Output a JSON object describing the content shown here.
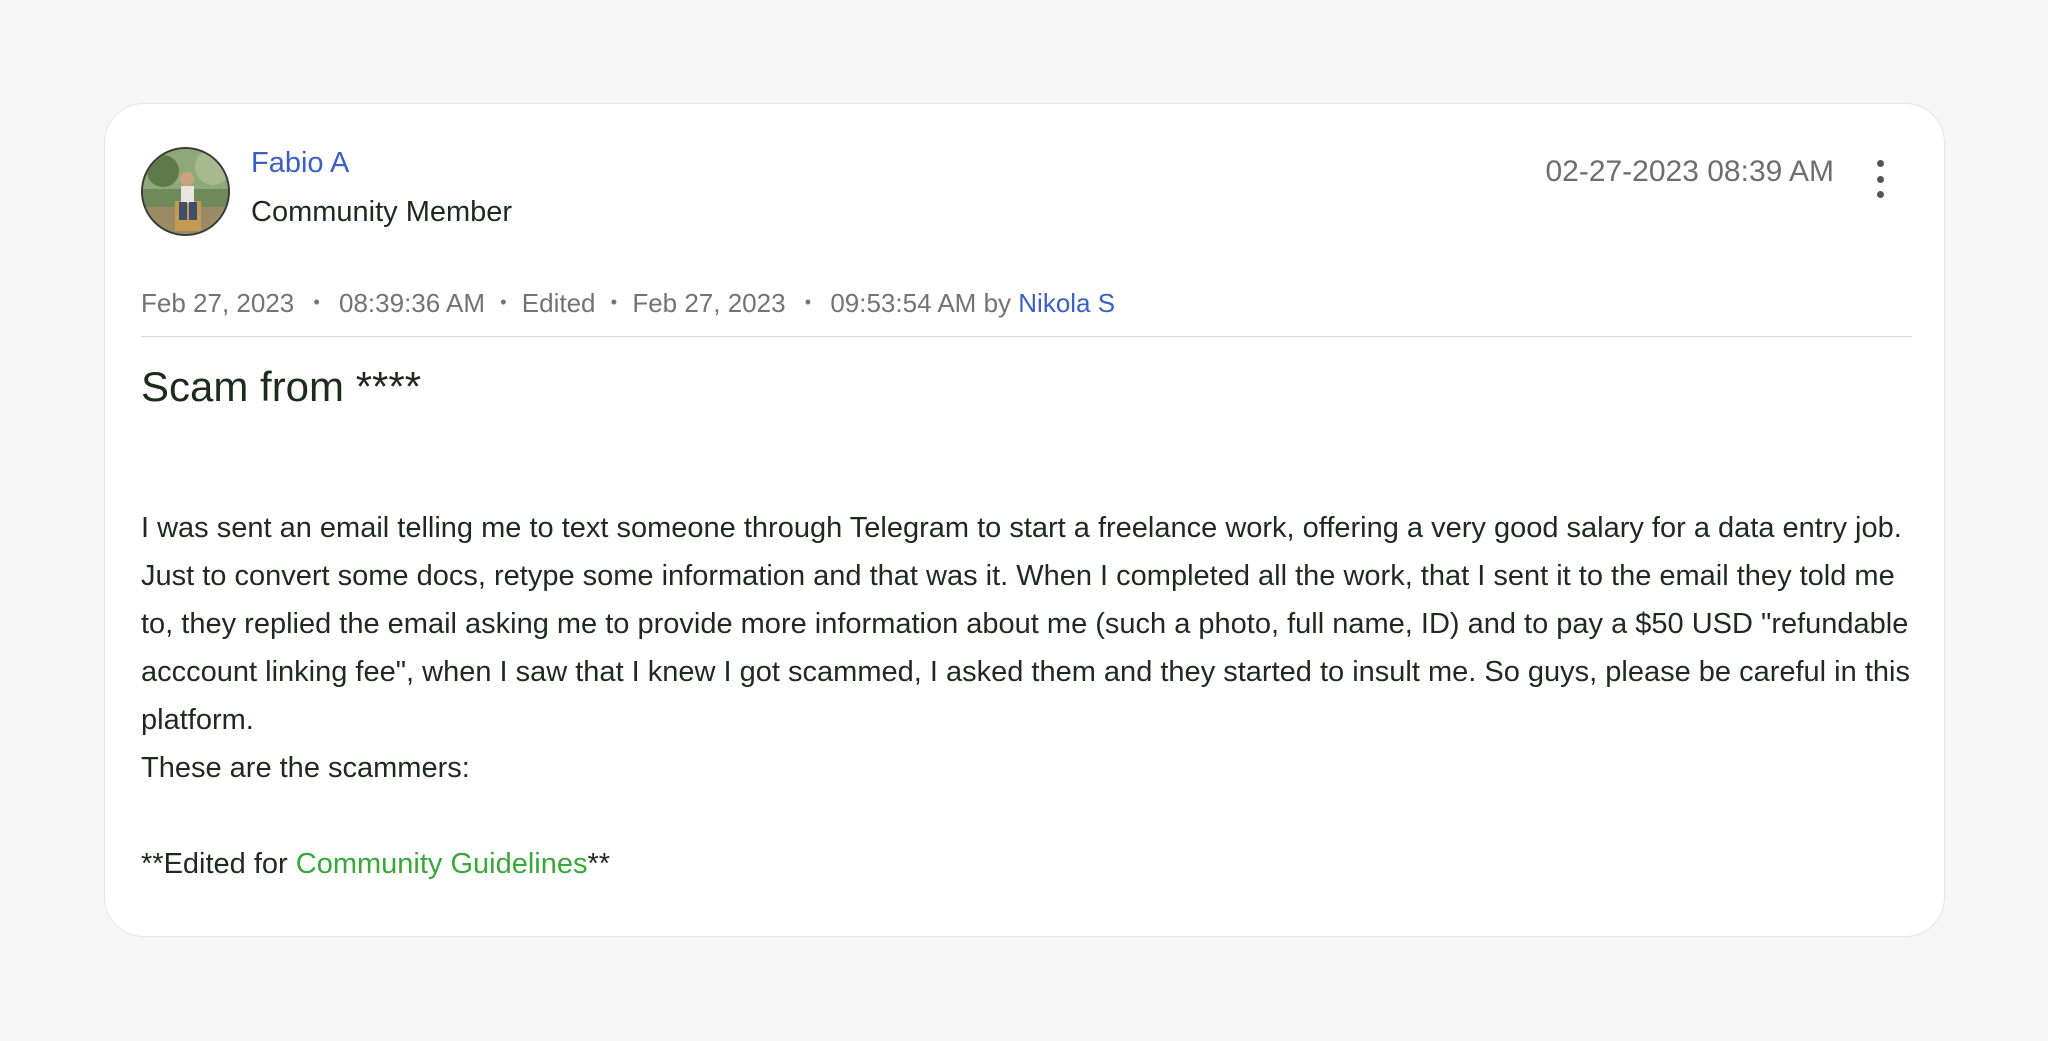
{
  "post": {
    "author": {
      "name": "Fabio A",
      "role": "Community Member"
    },
    "timestamp": "02-27-2023 08:39 AM",
    "meta": {
      "created_date": "Feb 27, 2023",
      "created_time": "08:39:36 AM",
      "edited_label": "Edited",
      "edited_date": "Feb 27, 2023",
      "edited_time": "09:53:54 AM",
      "by_label": "by",
      "editor": "Nikola S"
    },
    "title": "Scam from ****",
    "body": {
      "paragraph": "I was sent an email telling me to text someone through Telegram to start a freelance work, offering a very good salary for a data entry job. Just to convert some docs, retype some information and that was it. When I completed all the work, that I sent it to the email they told me to, they replied the email asking me to provide more information about me (such a photo, full name, ID) and to pay a $50 USD \"refundable acccount linking fee\", when I saw that I knew I got scammed, I asked them and they started to insult me. So guys, please be careful in this platform.",
      "scammers_line": "These are the scammers:",
      "edit_note_prefix": "**Edited for ",
      "edit_note_link": "Community Guidelines",
      "edit_note_suffix": "**"
    }
  },
  "icons": {
    "menu": "more-vertical-icon",
    "separator": "bullet-dot"
  },
  "colors": {
    "link_blue": "#3b5fc4",
    "link_green": "#3aa73a",
    "text": "#1d2b1d",
    "muted": "#737373"
  }
}
